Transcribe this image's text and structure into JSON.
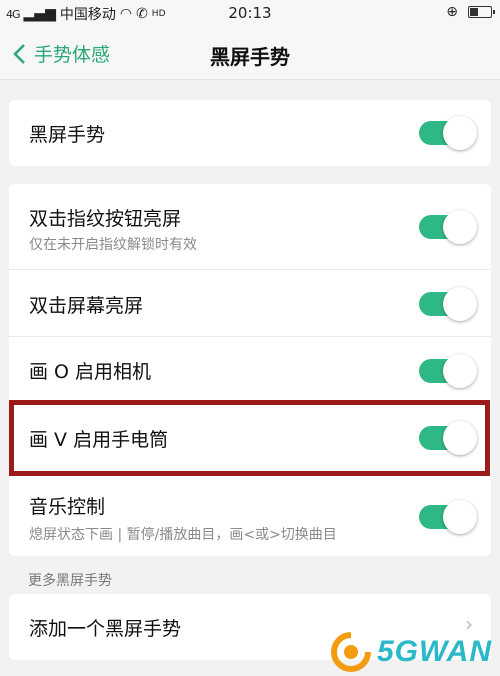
{
  "status_bar": {
    "signal": "4G",
    "carrier": "中国移动",
    "hd": "HD",
    "time": "20:13"
  },
  "nav": {
    "back_label": "手势体感",
    "title": "黑屏手势"
  },
  "main_toggle": {
    "label": "黑屏手势",
    "on": true
  },
  "gestures": [
    {
      "label": "双击指纹按钮亮屏",
      "sub": "仅在未开启指纹解锁时有效",
      "on": true
    },
    {
      "label": "双击屏幕亮屏",
      "on": true
    },
    {
      "label": "画 O 启用相机",
      "on": true
    },
    {
      "label": "画 V 启用手电筒",
      "on": true
    },
    {
      "label": "音乐控制",
      "sub": "熄屏状态下画 | 暂停/播放曲目，画<或>切换曲目",
      "on": true
    }
  ],
  "more_section": {
    "header": "更多黑屏手势",
    "add_label": "添加一个黑屏手势"
  },
  "watermark": {
    "text": "5GWAN"
  },
  "colors": {
    "accent": "#2eb886",
    "back": "#2aa876",
    "highlight": "#9b1b1b"
  }
}
